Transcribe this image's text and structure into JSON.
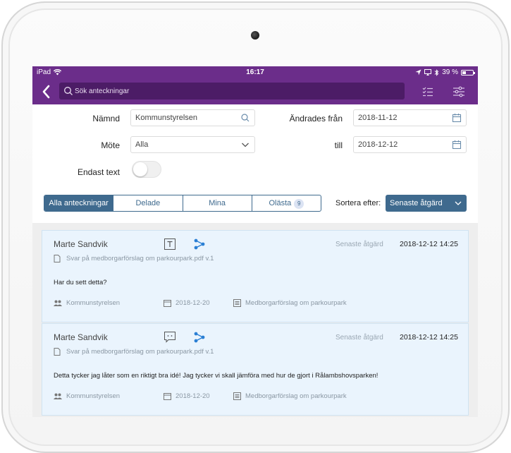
{
  "status": {
    "device": "iPad",
    "time": "16:17",
    "battery": "39 %",
    "battery_level": 0.39
  },
  "nav": {
    "search_placeholder": "Sök anteckningar"
  },
  "filters": {
    "board_label": "Nämnd",
    "board_value": "Kommunstyrelsen",
    "meeting_label": "Möte",
    "meeting_value": "Alla",
    "changed_from_label": "Ändrades från",
    "changed_from_value": "2018-11-12",
    "to_label": "till",
    "to_value": "2018-12-12",
    "text_only_label": "Endast text"
  },
  "segments": [
    {
      "label": "Alla anteckningar"
    },
    {
      "label": "Delade"
    },
    {
      "label": "Mina"
    },
    {
      "label": "Olästa",
      "badge": "9"
    }
  ],
  "sort": {
    "label": "Sortera efter:",
    "value": "Senaste åtgärd"
  },
  "notes": [
    {
      "author": "Marte Sandvik",
      "kind_icon": "text-note-icon",
      "sort_label": "Senaste åtgärd",
      "date": "2018-12-12 14:25",
      "document": "Svar på medborgarförslag om parkourpark.pdf v.1",
      "text": "Har du sett detta?",
      "group": "Kommunstyrelsen",
      "meeting_date": "2018-12-20",
      "agenda_item": "Medborgarförslag om parkourpark"
    },
    {
      "author": "Marte Sandvik",
      "kind_icon": "comment-note-icon",
      "sort_label": "Senaste åtgärd",
      "date": "2018-12-12 14:25",
      "document": "Svar på medborgarförslag om parkourpark.pdf v.1",
      "text": "Detta tycker jag låter som en riktigt bra idé! Jag tycker vi skall jämföra med hur de gjort i Rålambshovsparken!",
      "group": "Kommunstyrelsen",
      "meeting_date": "2018-12-20",
      "agenda_item": "Medborgarförslag om parkourpark"
    }
  ],
  "colors": {
    "brand": "#6b2d8a",
    "accent": "#3f6a8e",
    "share": "#2a7fd4"
  }
}
